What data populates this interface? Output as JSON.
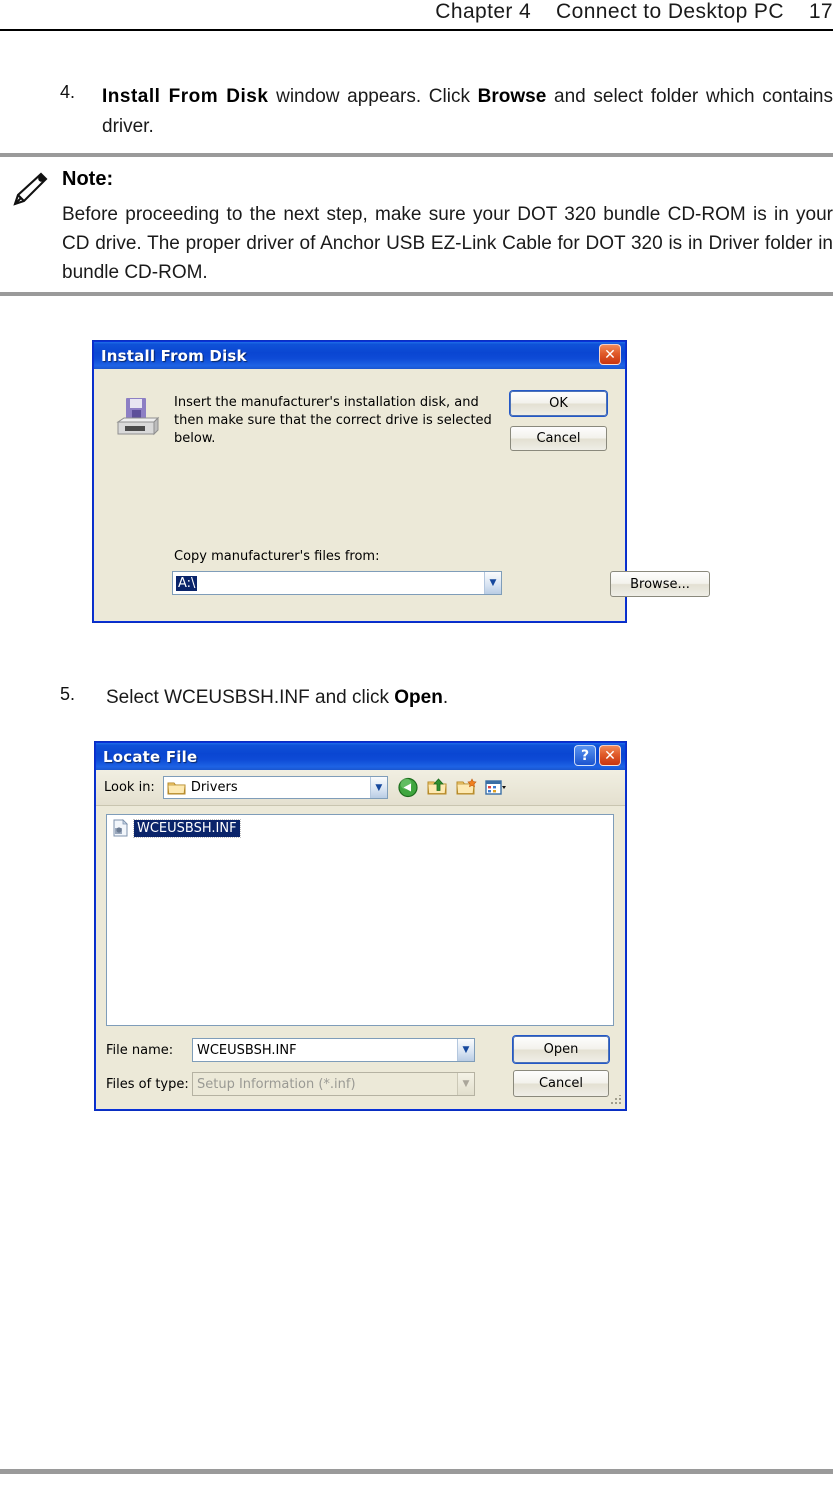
{
  "page": {
    "header": "Chapter 4    Connect to Desktop PC    17"
  },
  "step4": {
    "number": "4.",
    "text_part1": "Install From Disk",
    "text_part2": " window  appears.  Click  ",
    "text_part3": "Browse",
    "text_part4": "  and  select  folder  which contains driver."
  },
  "note": {
    "icon": "pencil-icon",
    "title": "Note:",
    "body": "Before proceeding to the next step, make sure your DOT 320 bundle CD-ROM is in your CD drive. The proper driver of Anchor USB EZ-Link Cable for DOT 320 is in Driver folder in bundle CD-ROM."
  },
  "install_from_disk_dialog": {
    "title": "Install From Disk",
    "close_label": "✕",
    "icon": "floppy-install-icon",
    "message": "Insert the manufacturer's installation disk, and then make sure that the correct drive is selected below.",
    "ok_label": "OK",
    "cancel_label": "Cancel",
    "copy_from_label": "Copy manufacturer's files from:",
    "path_value": "A:\\",
    "browse_label": "Browse...",
    "title_bg": "#0a46d2",
    "face": "#ece9d8"
  },
  "step5": {
    "number": "5.",
    "text_part1": "Select WCEUSBSH.INF and click ",
    "text_part2": "Open",
    "text_part3": "."
  },
  "locate_file_dialog": {
    "title": "Locate File",
    "help_label": "?",
    "close_label": "✕",
    "look_in_label": "Look in:",
    "look_in_value": "Drivers",
    "toolbar_icons": [
      "back-icon",
      "up-one-level-icon",
      "new-folder-icon",
      "views-icon"
    ],
    "files": [
      {
        "name": "WCEUSBSH.INF",
        "icon": "inf-file-icon",
        "selected": true
      }
    ],
    "file_name_label": "File name:",
    "file_name_value": "WCEUSBSH.INF",
    "files_of_type_label": "Files of type:",
    "files_of_type_value": "Setup Information (*.inf)",
    "open_label": "Open",
    "cancel_label": "Cancel"
  }
}
